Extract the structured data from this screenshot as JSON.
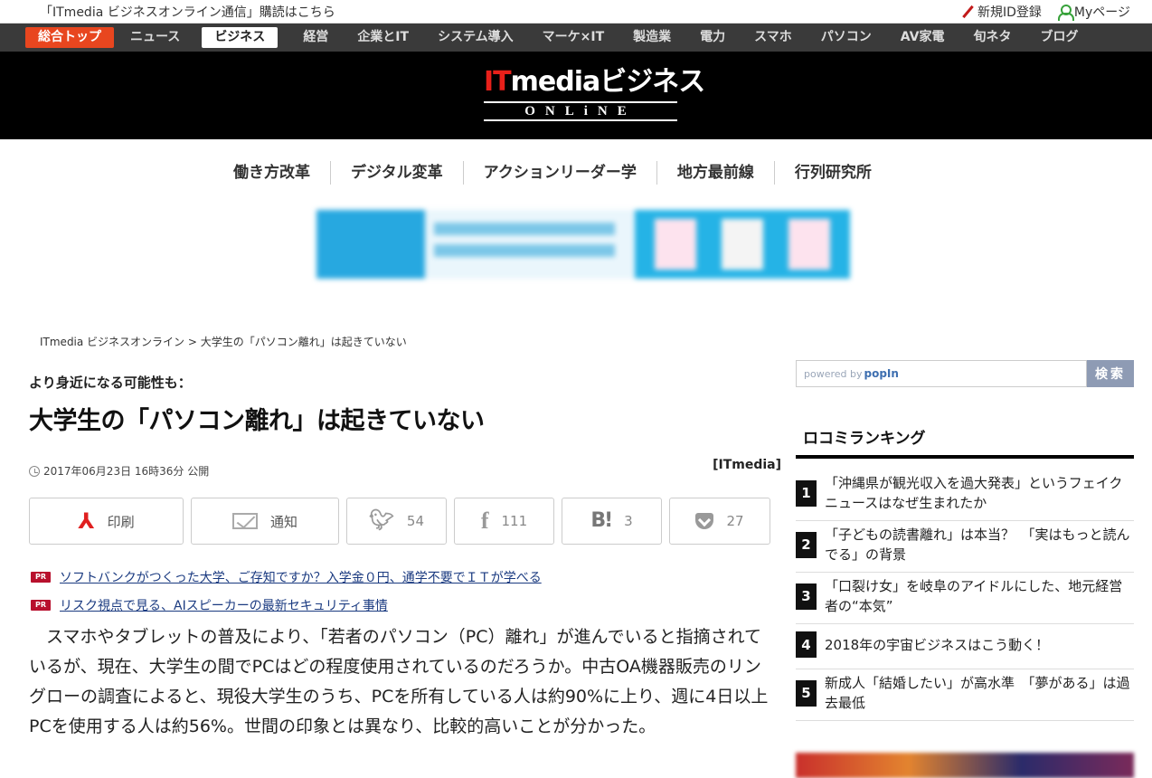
{
  "util": {
    "subscribe": "「ITmedia ビジネスオンライン通信」購読はこちら",
    "register": "新規ID登録",
    "mypage": "Myページ"
  },
  "nav": {
    "top": "総合トップ",
    "items": [
      "ニュース",
      "ビジネス",
      "経営",
      "企業とIT",
      "システム導入",
      "マーケ×IT",
      "製造業",
      "電力",
      "スマホ",
      "パソコン",
      "AV家電",
      "旬ネタ",
      "ブログ"
    ],
    "active": "ビジネス"
  },
  "logo": {
    "part1": "IT",
    "part2": "mediaビジネス",
    "part3": "ONLiNE"
  },
  "features": [
    "働き方改革",
    "デジタル変革",
    "アクションリーダー学",
    "地方最前線",
    "行列研究所"
  ],
  "breadcrumb": "ITmedia ビジネスオンライン > 大学生の「パソコン離れ」は起きていない",
  "article": {
    "kicker": "より身近になる可能性も：",
    "title": "大学生の「パソコン離れ」は起きていない",
    "date": "2017年06月23日 16時36分 公開",
    "source": "[ITmedia]",
    "share": {
      "print": "印刷",
      "notify": "通知",
      "twitter_count": "54",
      "facebook_count": "111",
      "hatena_count": "3",
      "pocket_count": "27"
    },
    "pr": [
      "ソフトバンクがつくった大学、ご存知ですか？入学金０円、通学不要でＩＴが学べる",
      "リスク視点で見る、AIスピーカーの最新セキュリティ事情"
    ],
    "pr_tag": "PR",
    "body": "　スマホやタブレットの普及により、「若者のパソコン（PC）離れ」が進んでいると指摘されているが、現在、大学生の間でPCはどの程度使用されているのだろうか。中古OA機器販売のリングローの調査によると、現役大学生のうち、PCを所有している人は約90%に上り、週に4日以上PCを使用する人は約56%。世間の印象とは異なり、比較的高いことが分かった。"
  },
  "sidebar": {
    "search_powered": "powered by",
    "search_brand": "popIn",
    "search_button": "検索",
    "ranking_title": "ロコミランキング",
    "ranking": [
      {
        "num": "1",
        "text": "「沖縄県が観光収入を過大発表」というフェイクニュースはなぜ生まれたか"
      },
      {
        "num": "2",
        "text": "「子どもの読書離れ」は本当？　「実はもっと読んでる」の背景"
      },
      {
        "num": "3",
        "text": "「口裂け女」を岐阜のアイドルにした、地元経営者の“本気”"
      },
      {
        "num": "4",
        "text": "2018年の宇宙ビジネスはこう動く！"
      },
      {
        "num": "5",
        "text": "新成人「結婚したい」が高水準　「夢がある」は過去最低"
      }
    ]
  },
  "colors": {
    "nav_bg": "#3a3a3a",
    "top_tab": "#e8461f",
    "logo_red": "#e8201a",
    "pr_tag": "#b8102d",
    "link": "#1a3a80"
  }
}
